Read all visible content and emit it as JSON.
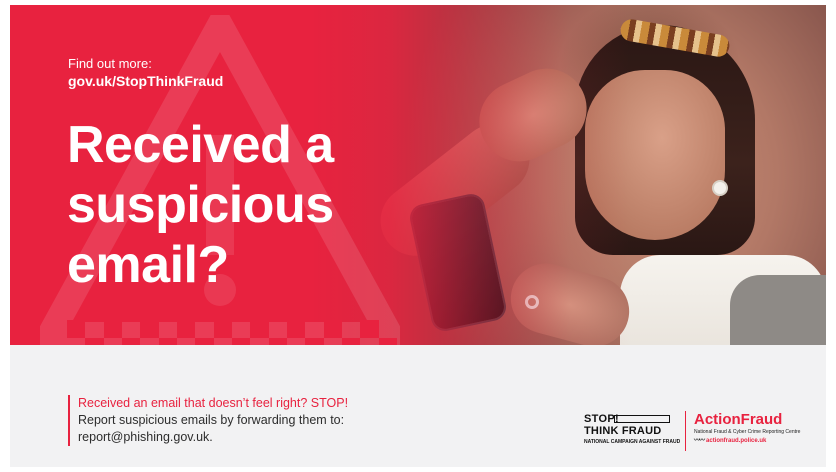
{
  "hero": {
    "find_out_label": "Find out more:",
    "find_out_url": "gov.uk/StopThinkFraud",
    "headline_lines": [
      "Received a",
      "suspicious",
      "email?"
    ]
  },
  "message": {
    "line1": "Received an email that doesn’t feel right? STOP!",
    "line2": "Report suspicious emails by forwarding them to:",
    "line3": "report@phishing.gov.uk."
  },
  "logos": {
    "stop_think_fraud": {
      "stop": "STOP!",
      "think_fraud": "THINK FRAUD",
      "tagline": "NATIONAL CAMPAIGN AGAINST FRAUD"
    },
    "action_fraud": {
      "name": "ActionFraud",
      "subtitle": "National Fraud & Cyber Crime Reporting Centre",
      "url": "actionfraud.police.uk"
    }
  },
  "colors": {
    "brand_red": "#e8223f",
    "text_dark": "#2d2d2d",
    "background_light": "#f2f2f3"
  }
}
